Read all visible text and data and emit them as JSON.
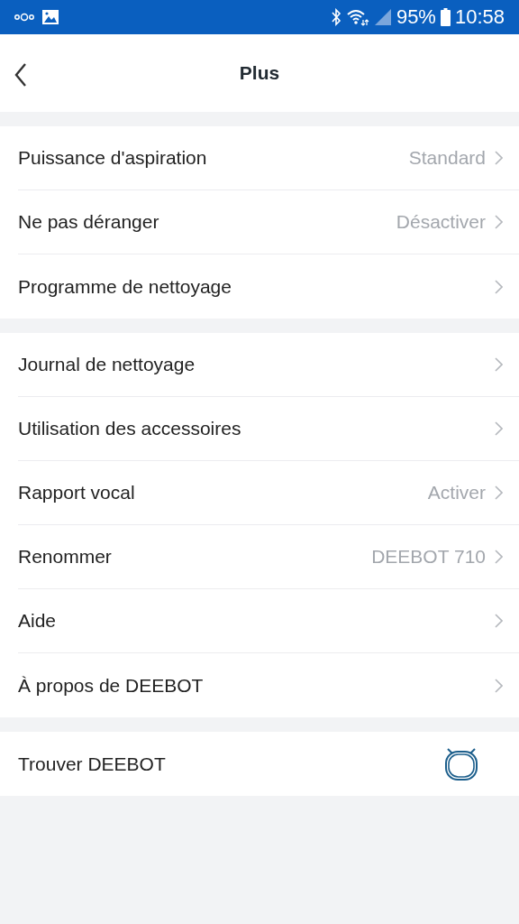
{
  "status_bar": {
    "battery": "95%",
    "time": "10:58"
  },
  "header": {
    "title": "Plus"
  },
  "sections": [
    {
      "rows": [
        {
          "kind": "link",
          "label": "Puissance d'aspiration",
          "value": "Standard"
        },
        {
          "kind": "link",
          "label": "Ne pas déranger",
          "value": "Désactiver"
        },
        {
          "kind": "link",
          "label": "Programme de nettoyage"
        }
      ]
    },
    {
      "rows": [
        {
          "kind": "link",
          "label": "Journal de nettoyage"
        },
        {
          "kind": "link",
          "label": "Utilisation des accessoires"
        },
        {
          "kind": "link",
          "label": "Rapport vocal",
          "value": "Activer"
        },
        {
          "kind": "link",
          "label": "Renommer",
          "value": "DEEBOT 710"
        },
        {
          "kind": "link",
          "label": "Aide"
        },
        {
          "kind": "link",
          "label": "À propos de DEEBOT"
        }
      ]
    },
    {
      "rows": [
        {
          "kind": "find",
          "label": "Trouver DEEBOT"
        }
      ]
    }
  ]
}
